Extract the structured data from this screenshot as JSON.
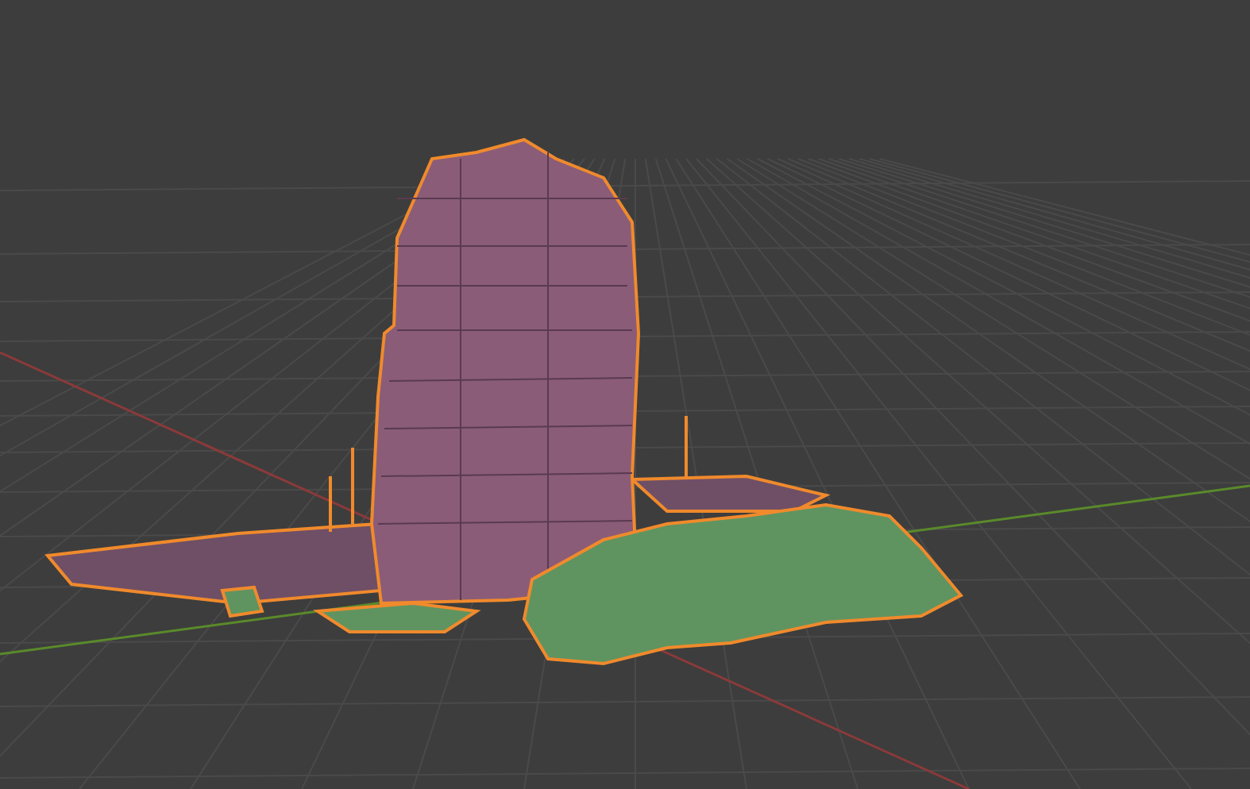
{
  "viewport": {
    "objects": [
      {
        "kind": "slab",
        "selected": true
      },
      {
        "kind": "tower",
        "selected": true
      },
      {
        "kind": "debris",
        "selected": true
      }
    ]
  }
}
